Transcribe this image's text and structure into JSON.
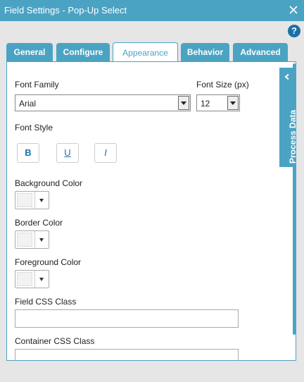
{
  "window": {
    "title": "Field Settings - Pop-Up Select"
  },
  "help": {
    "label": "?"
  },
  "tabs": [
    {
      "label": "General"
    },
    {
      "label": "Configure"
    },
    {
      "label": "Appearance"
    },
    {
      "label": "Behavior"
    },
    {
      "label": "Advanced"
    }
  ],
  "active_tab": "Appearance",
  "form": {
    "font_family": {
      "label": "Font Family",
      "value": "Arial"
    },
    "font_size": {
      "label": "Font Size (px)",
      "value": "12"
    },
    "font_style": {
      "label": "Font Style",
      "bold": "B",
      "underline": "U",
      "italic": "I"
    },
    "background_color": {
      "label": "Background Color"
    },
    "border_color": {
      "label": "Border Color"
    },
    "foreground_color": {
      "label": "Foreground Color"
    },
    "field_css_class": {
      "label": "Field CSS Class",
      "value": ""
    },
    "container_css_class": {
      "label": "Container CSS Class",
      "value": ""
    }
  },
  "side_panel": {
    "label": "Process Data"
  },
  "colors": {
    "accent": "#4ba3c3",
    "help": "#1a6fa8",
    "background": "#e6e6e6"
  }
}
